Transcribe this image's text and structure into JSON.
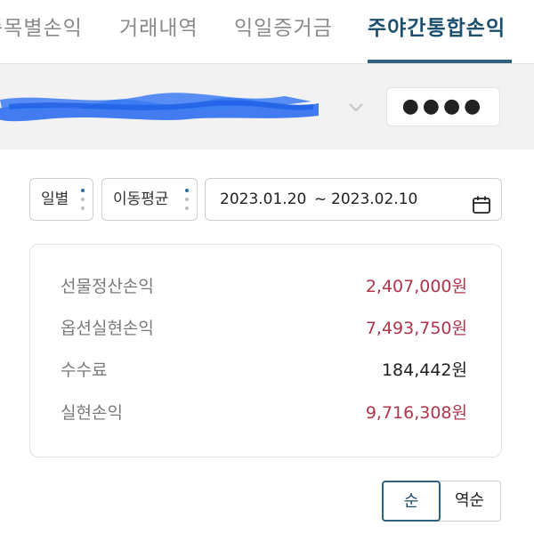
{
  "tabs": [
    {
      "label": "종목별손익",
      "active": false
    },
    {
      "label": "거래내역",
      "active": false
    },
    {
      "label": "익일증거금",
      "active": false
    },
    {
      "label": "주야간통합손익",
      "active": true
    }
  ],
  "account": {
    "masked": true,
    "pin_mask": "●●●●"
  },
  "filters": {
    "period": "일별",
    "average": "이동평균",
    "date_from": "2023.01.20",
    "date_separator": "~",
    "date_to": "2023.02.10"
  },
  "summary": [
    {
      "label": "선물정산손익",
      "value": "2,407,000원",
      "tone": "red"
    },
    {
      "label": "옵션실현손익",
      "value": "7,493,750원",
      "tone": "red"
    },
    {
      "label": "수수료",
      "value": "184,442원",
      "tone": "black"
    },
    {
      "label": "실현손익",
      "value": "9,716,308원",
      "tone": "red"
    }
  ],
  "sort": {
    "asc_label": "순",
    "desc_label": "역순",
    "selected": "asc"
  },
  "colors": {
    "accent": "#2f6180",
    "profit": "#b0344a",
    "mask_blue": "#2f6ff0"
  }
}
